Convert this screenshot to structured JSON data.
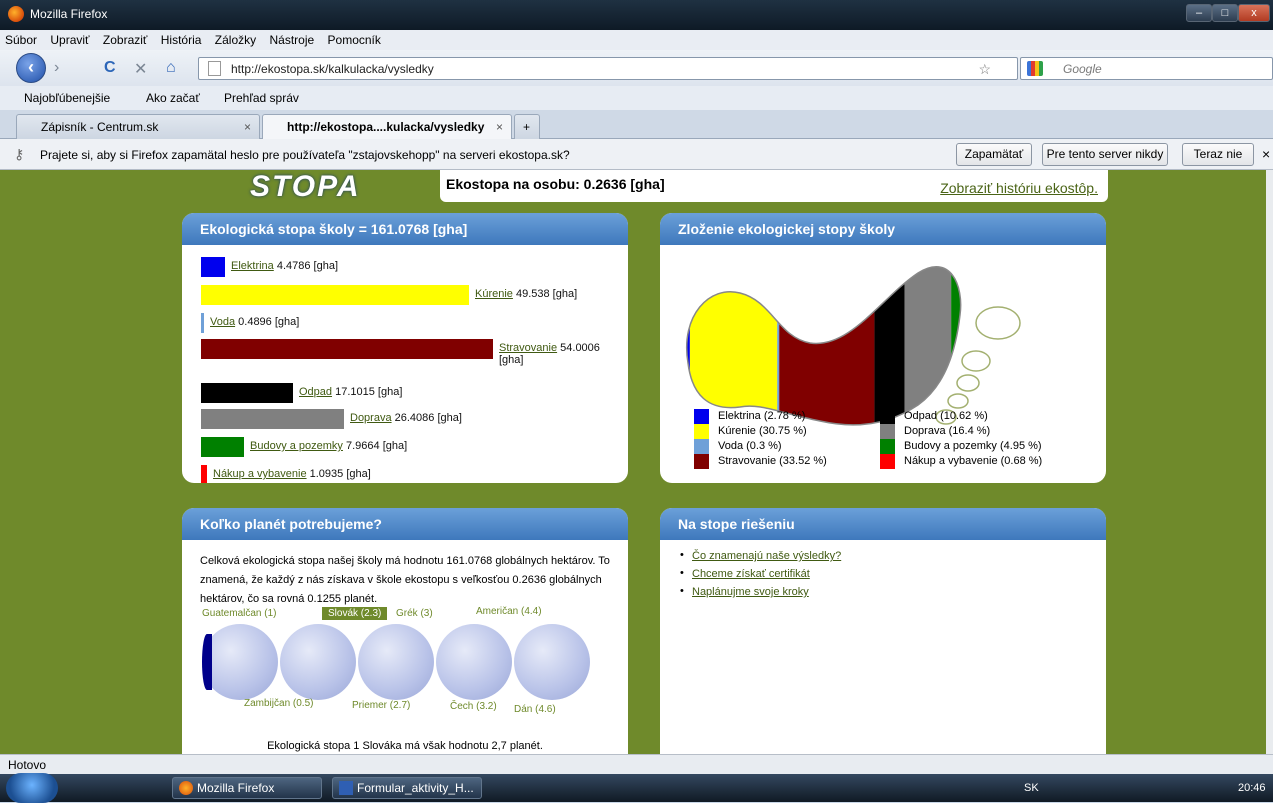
{
  "window": {
    "title": "Mozilla Firefox",
    "min": "–",
    "max": "□",
    "close": "x"
  },
  "menu": [
    "Súbor",
    "Upraviť",
    "Zobraziť",
    "História",
    "Záložky",
    "Nástroje",
    "Pomocník"
  ],
  "nav": {
    "url": "http://ekostopa.sk/kalkulacka/vysledky",
    "search_placeholder": "Google",
    "back": "‹",
    "forward": "›",
    "reload": "C",
    "stop": "✕",
    "home": "⌂",
    "star": "☆"
  },
  "bookmarks": [
    "Najobľúbenejšie",
    "Ako začať",
    "Prehľad správ"
  ],
  "tabs": [
    {
      "label": "Zápisník - Centrum.sk",
      "close": "×"
    },
    {
      "label": "http://ekostopa....kulacka/vysledky",
      "close": "×"
    }
  ],
  "new_tab": "+",
  "notification": {
    "message": "Prajete si, aby si Firefox zapamätal heslo pre používateľa \"zstajovskehopp\" na serveri ekostopa.sk?",
    "remember": "Zapamätať",
    "never": "Pre tento server nikdy",
    "not_now": "Teraz nie",
    "close": "×"
  },
  "page": {
    "logo": "STOPA",
    "per_person": "Ekostopa na osobu: 0.2636 [gha]",
    "history_link": "Zobraziť históriu ekostôp."
  },
  "school_footprint": {
    "title": "Ekologická stopa školy = 161.0768 [gha]"
  },
  "chart_data": {
    "type": "bar",
    "title": "Ekologická stopa školy = 161.0768 [gha]",
    "categories": [
      "Elektrina",
      "Kúrenie",
      "Voda",
      "Stravovanie",
      "Odpad",
      "Doprava",
      "Budovy a pozemky",
      "Nákup a vybavenie"
    ],
    "values": [
      4.4786,
      49.538,
      0.4896,
      54.0006,
      17.1015,
      26.4086,
      7.9664,
      1.0935
    ],
    "value_labels": [
      "4.4786 [gha]",
      "49.538 [gha]",
      "0.4896 [gha]",
      "54.0006 [gha]",
      "17.1015 [gha]",
      "26.4086 [gha]",
      "7.9664 [gha]",
      "1.0935 [gha]"
    ],
    "colors": [
      "#0000ee",
      "#ffff00",
      "#6fa0d8",
      "#800000",
      "#000000",
      "#808080",
      "#008000",
      "#ff0000"
    ]
  },
  "composition": {
    "title": "Zloženie ekologickej stopy školy",
    "shares": [
      2.78,
      30.75,
      0.3,
      33.52,
      10.62,
      16.4,
      4.95,
      0.68
    ],
    "legend_left": [
      "Elektrina (2.78 %)",
      "Kúrenie (30.75 %)",
      "Voda (0.3 %)",
      "Stravovanie (33.52 %)"
    ],
    "legend_right": [
      "Odpad (10.62 %)",
      "Doprava (16.4 %)",
      "Budovy a pozemky (4.95 %)",
      "Nákup a vybavenie (0.68 %)"
    ],
    "colors_left": [
      "#0000ee",
      "#ffff00",
      "#6fa0d8",
      "#800000"
    ],
    "colors_right": [
      "#000000",
      "#808080",
      "#008000",
      "#ff0000"
    ]
  },
  "planets": {
    "title": "Koľko planét potrebujeme?",
    "text": "Celková ekologická stopa našej školy má hodnotu 161.0768 globálnych hektárov. To znamená, že každý z nás získava v škole ekostopu s veľkosťou 0.2636 globálnych hektárov, čo sa rovná 0.1255 planét.",
    "labels_top": [
      "Guatemalčan (1)",
      "Slovák (2.3)",
      "Grék (3)",
      "Američan (4.4)"
    ],
    "labels_bottom": [
      "Zambijčan (0.5)",
      "Priemer (2.7)",
      "Čech (3.2)",
      "Dán (4.6)"
    ],
    "footer": "Ekologická stopa 1 Slováka má však hodnotu 2,7 planét."
  },
  "solution": {
    "title": "Na stope riešeniu",
    "links": [
      "Čo znamenajú naše výsledky?",
      "Chceme získať certifikát",
      "Naplánujme svoje kroky"
    ]
  },
  "status": "Hotovo",
  "taskbar": {
    "items": [
      "Mozilla Firefox",
      "Formular_aktivity_H..."
    ],
    "lang": "SK",
    "time": "20:46"
  }
}
